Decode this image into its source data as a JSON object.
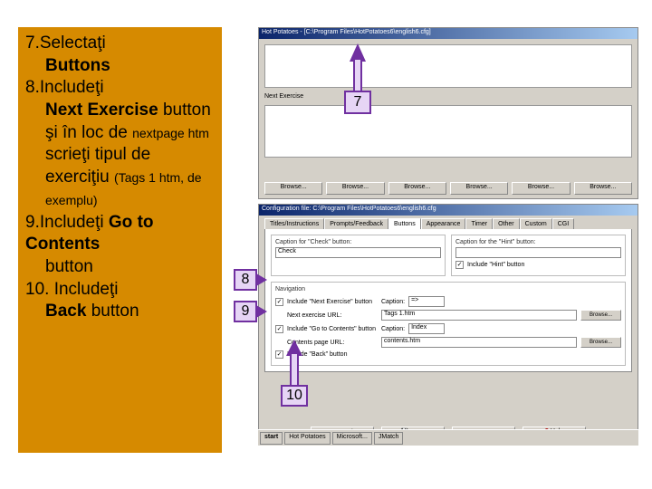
{
  "left": {
    "step7_num": "7.",
    "step7_a": "Selectaţi",
    "step7_b": "Buttons",
    "step8_num": "8.",
    "step8_a": "Includeţi",
    "step8_b": "Next Exercise",
    "step8_c": "button şi în loc de ",
    "step8_d": "nextpage htm",
    "step8_e": " scrieţi tipul de exerciţiu ",
    "step8_f": "(Tags 1 htm, de exemplu)",
    "step9_num": "9.",
    "step9_a": "Includeţi ",
    "step9_b": "Go to Contents",
    "step9_c": " button",
    "step10_num": "10.",
    "step10_a": " Includeţi ",
    "step10_b": "Back",
    "step10_c": " button"
  },
  "callouts": {
    "c7": "7",
    "c8": "8",
    "c9": "9",
    "c10": "10"
  },
  "screenshot1": {
    "title": "Hot Potatoes - [C:\\Program Files\\HotPotatoes6\\english6.cfg]",
    "buttons": [
      "Browse...",
      "Browse...",
      "Browse...",
      "Browse...",
      "Browse...",
      "Browse..."
    ]
  },
  "screenshot2": {
    "title": "Configuration file: C:\\Program Files\\HotPotatoes6\\english6.cfg",
    "tabs": [
      "Titles/Instructions",
      "Prompts/Feedback",
      "Buttons",
      "Appearance",
      "Timer",
      "Other",
      "Custom",
      "CGI"
    ],
    "active_tab": "Buttons",
    "cap1_label": "Caption for \"Check\" button:",
    "cap1_value": "Check",
    "cap2_label": "Caption for the \"Hint\" button:",
    "cap2_value": "",
    "hint_check": "Include \"Hint\" button",
    "nav_header": "Navigation",
    "nav1_check": "Include \"Next Exercise\" button",
    "nav1_label": "Caption:",
    "nav1_value": "=>",
    "nav2_label": "Next exercise URL:",
    "nav2_value": "Tags 1.htm",
    "nav3_check": "Include \"Go to Contents\" button",
    "nav3_label": "Caption:",
    "nav3_value": "Index",
    "nav4_label": "Contents page URL:",
    "nav4_value": "contents.htm",
    "nav5_check": "Include \"Back\" button",
    "browse": "Browse...",
    "btn_load": "Load",
    "btn_save": "Save",
    "btn_ok": "OK",
    "btn_help": "Help"
  },
  "taskbar": {
    "start": "start",
    "items": [
      "",
      "Hot Potatoes",
      "Microsoft...",
      "JMatch"
    ]
  }
}
